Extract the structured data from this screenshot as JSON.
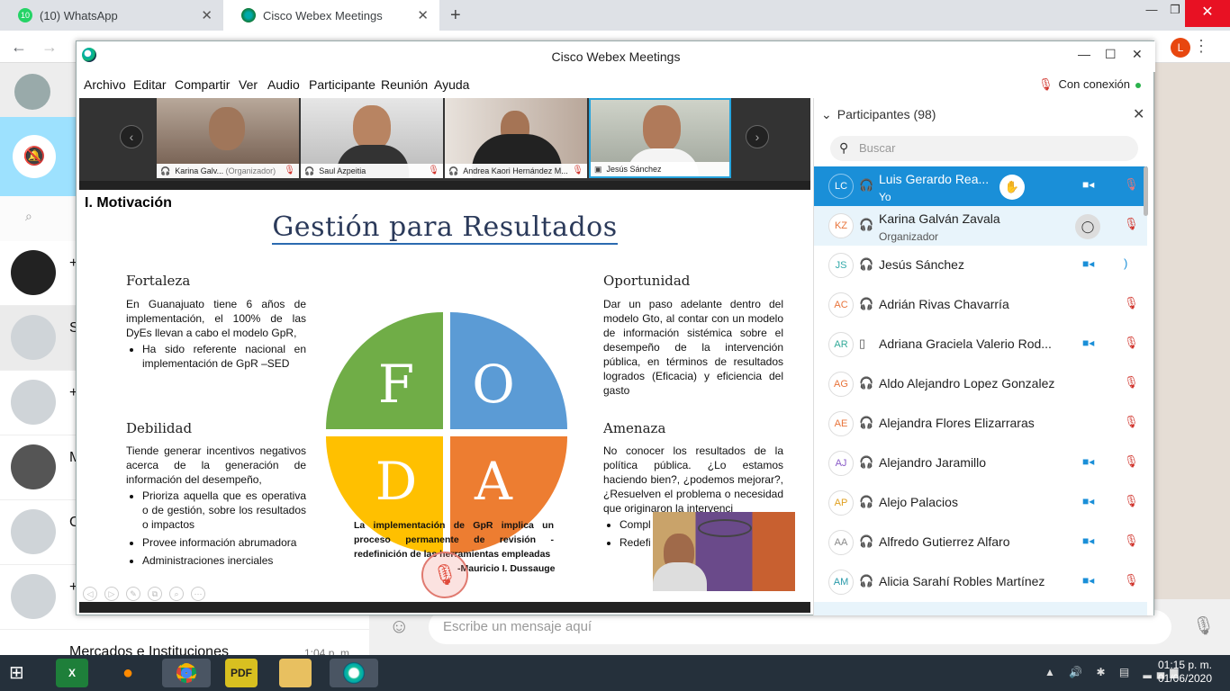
{
  "browser": {
    "tabs": [
      {
        "label": "(10) WhatsApp",
        "badge": "10"
      },
      {
        "label": "Cisco Webex Meetings"
      }
    ],
    "new_tab": "+"
  },
  "whatsapp": {
    "chats": [
      {
        "name": "+"
      },
      {
        "name": "S"
      },
      {
        "name": "+"
      },
      {
        "name": "M"
      },
      {
        "name": "C"
      },
      {
        "name": "+"
      },
      {
        "name": "Mercados e Instituciones",
        "time": "1:04 p. m."
      }
    ],
    "composer_placeholder": "Escribe un mensaje aquí"
  },
  "webex": {
    "window_title": "Cisco Webex Meetings",
    "menu": [
      "Archivo",
      "Editar",
      "Compartir",
      "Ver",
      "Audio",
      "Participante",
      "Reunión",
      "Ayuda"
    ],
    "connection_status": "Con conexión",
    "videos": [
      {
        "name": "Karina  Galv...",
        "role": "(Organizador)"
      },
      {
        "name": "Saul Azpeitia",
        "role": ""
      },
      {
        "name": "Andrea Kaori Hernández M...",
        "role": ""
      },
      {
        "name": "Jesús Sánchez",
        "role": ""
      }
    ],
    "slide": {
      "heading": "I. Motivación",
      "title": "Gestión para Resultados",
      "foda_letters": [
        "F",
        "O",
        "D",
        "A"
      ],
      "fortaleza": {
        "title": "Fortaleza",
        "text": "En Guanajuato tiene 6 años de implementación, el 100% de las DyEs llevan a cabo el modelo GpR,",
        "bullets": [
          "Ha sido referente nacional en implementación de GpR –SED"
        ]
      },
      "oportunidad": {
        "title": "Oportunidad",
        "text": "Dar un paso adelante dentro del modelo Gto, al contar con un modelo de información sistémica sobre el desempeño de la intervención pública, en términos de resultados logrados (Eficacia) y eficiencia del gasto"
      },
      "debilidad": {
        "title": "Debilidad",
        "text": "Tiende generar incentivos negativos acerca de la generación de información del desempeño,",
        "bullets": [
          "Prioriza aquella que es operativa o de gestión, sobre los resultados o impactos",
          "Provee información abrumadora",
          "Administraciones inerciales"
        ]
      },
      "amenaza": {
        "title": "Amenaza",
        "text": "No conocer los resultados de la política pública. ¿Lo estamos haciendo bien?, ¿podemos mejorar?, ¿Resuelven el problema o necesidad que originaron la intervenci",
        "bullets": [
          "Compl",
          "Redefi"
        ]
      },
      "quote": "La implementación de GpR implica un proceso permanente de revisión - redefinición de las herramientas empleadas",
      "quote_author": "-Mauricio I. Dussauge"
    },
    "participants_panel": {
      "title": "Participantes (98)",
      "search_placeholder": "Buscar",
      "list": [
        {
          "initials": "LC",
          "name": "Luis Gerardo Rea...",
          "role": "Yo"
        },
        {
          "initials": "KZ",
          "name": "Karina  Galván Zavala",
          "role": "Organizador"
        },
        {
          "initials": "JS",
          "name": "Jesús Sánchez",
          "role": ""
        },
        {
          "initials": "AC",
          "name": "Adrián Rivas Chavarría",
          "role": ""
        },
        {
          "initials": "AR",
          "name": "Adriana Graciela Valerio Rod...",
          "role": ""
        },
        {
          "initials": "AG",
          "name": "Aldo Alejandro Lopez Gonzalez",
          "role": ""
        },
        {
          "initials": "AE",
          "name": "Alejandra Flores Elizarraras",
          "role": ""
        },
        {
          "initials": "AJ",
          "name": "Alejandro Jaramillo",
          "role": ""
        },
        {
          "initials": "AP",
          "name": "Alejo Palacios",
          "role": ""
        },
        {
          "initials": "AA",
          "name": "Alfredo Gutierrez Alfaro",
          "role": ""
        },
        {
          "initials": "AM",
          "name": "Alicia Sarahí Robles Martínez",
          "role": ""
        }
      ]
    }
  },
  "taskbar": {
    "time": "01:15 p. m.",
    "date": "01/06/2020"
  },
  "colors": {
    "webex_blue": "#1a8fd8",
    "mute_red": "#d0332b",
    "foda_green": "#70ad47",
    "foda_blue": "#5b9bd5",
    "foda_yellow": "#ffc000",
    "foda_orange": "#ed7d31"
  }
}
